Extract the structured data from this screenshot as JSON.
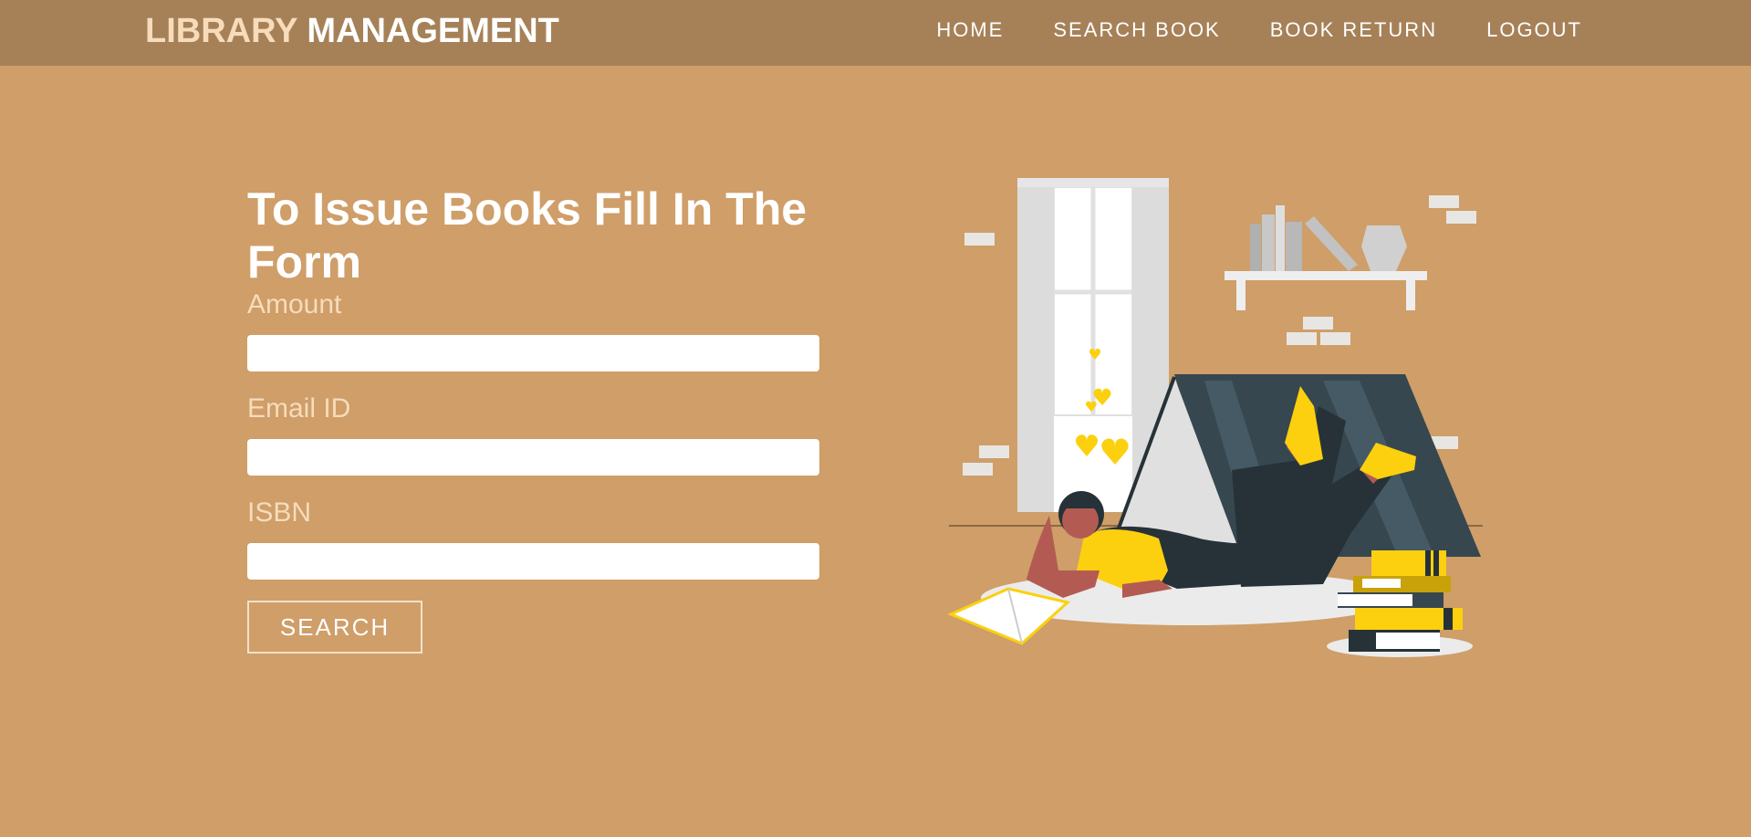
{
  "brand": {
    "part1": "LIBRARY",
    "part2": "MANAGEMENT"
  },
  "nav": {
    "home": "HOME",
    "search_book": "SEARCH BOOK",
    "book_return": "BOOK RETURN",
    "logout": "LOGOUT"
  },
  "form": {
    "heading": "To Issue Books Fill In The Form",
    "amount_label": "Amount",
    "amount_value": "",
    "email_label": "Email ID",
    "email_value": "",
    "isbn_label": "ISBN",
    "isbn_value": "",
    "search_label": "SEARCH"
  },
  "colors": {
    "background": "#cf9e69",
    "navbar": "#a68158",
    "brand_accent": "#f7dcbb",
    "label": "#f7dcbb",
    "illustration_yellow": "#fcd00f",
    "illustration_dark": "#263238"
  },
  "icons": {
    "illustration": "girl-reading-book-illustration"
  }
}
